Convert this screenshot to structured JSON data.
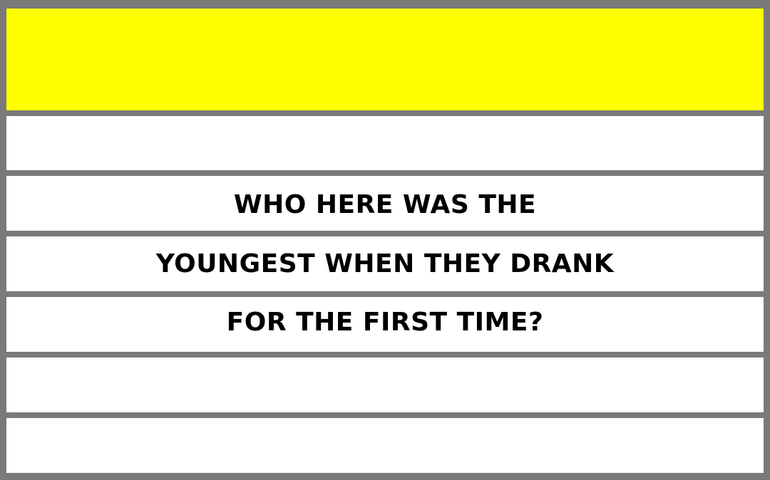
{
  "colors": {
    "frame": "#7a7a7a",
    "header_fill": "#ffff00",
    "row_fill": "#ffffff",
    "text": "#000000"
  },
  "question": {
    "line1": "WHO HERE WAS THE",
    "line2": "YOUNGEST WHEN THEY DRANK",
    "line3": "FOR THE FIRST TIME?"
  }
}
